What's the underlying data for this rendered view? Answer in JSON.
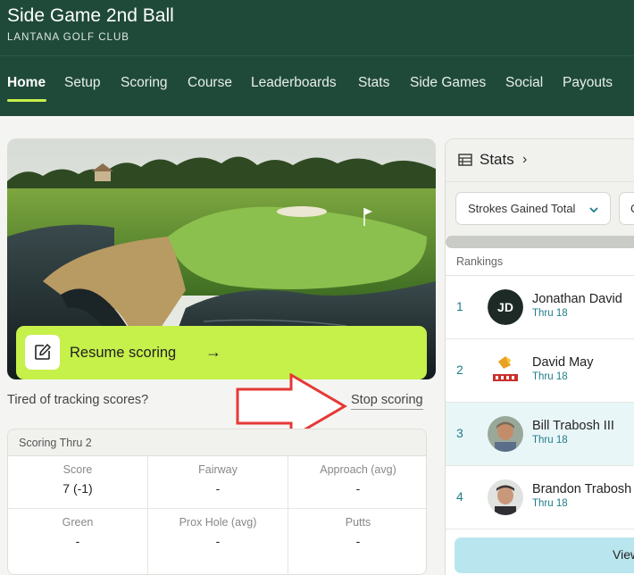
{
  "header": {
    "title": "Side Game 2nd Ball",
    "subtitle": "LANTANA GOLF CLUB"
  },
  "nav": {
    "items": [
      {
        "label": "Home",
        "active": true
      },
      {
        "label": "Setup"
      },
      {
        "label": "Scoring"
      },
      {
        "label": "Course"
      },
      {
        "label": "Leaderboards"
      },
      {
        "label": "Stats"
      },
      {
        "label": "Side Games"
      },
      {
        "label": "Social"
      },
      {
        "label": "Payouts"
      }
    ]
  },
  "resume": {
    "label": "Resume scoring",
    "arrow": "→",
    "icon": "edit-icon"
  },
  "stop_prompt": {
    "text": "Tired of tracking scores?",
    "link": "Stop scoring"
  },
  "scoring_card": {
    "title": "Scoring Thru 2",
    "cells": [
      {
        "label": "Score",
        "value": "7 (-1)"
      },
      {
        "label": "Fairway",
        "value": "-"
      },
      {
        "label": "Approach (avg)",
        "value": "-"
      },
      {
        "label": "Green",
        "value": "-"
      },
      {
        "label": "Prox Hole (avg)",
        "value": "-"
      },
      {
        "label": "Putts",
        "value": "-"
      }
    ]
  },
  "stats": {
    "title": "Stats",
    "chevron": "›",
    "icon": "table-icon",
    "select_value": "Strokes Gained Total",
    "select2_value": "C",
    "rankings_label": "Rankings",
    "rows": [
      {
        "rank": "1",
        "name": "Jonathan David",
        "sub": "Thru 18",
        "initials": "JD"
      },
      {
        "rank": "2",
        "name": "David May",
        "sub": "Thru 18"
      },
      {
        "rank": "3",
        "name": "Bill Trabosh III",
        "sub": "Thru 18"
      },
      {
        "rank": "4",
        "name": "Brandon Trabosh",
        "sub": "Thru 18"
      }
    ],
    "view_label": "View"
  },
  "colors": {
    "header_bg": "#1f4a3a",
    "accent_lime": "#c6f04a",
    "teal_text": "#1f7d8c",
    "highlight_row": "#e9f6f8",
    "annotation_red": "#e53935"
  }
}
